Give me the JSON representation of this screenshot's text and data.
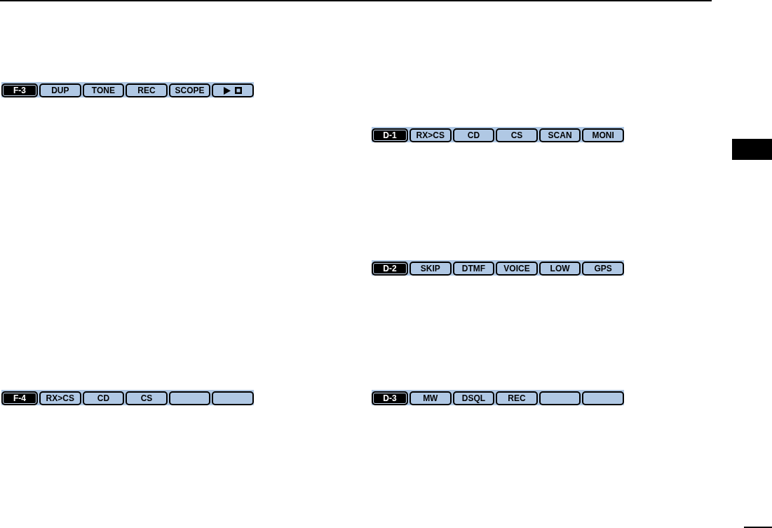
{
  "columns": [
    {
      "bars": [
        {
          "page": "F-3",
          "keys": [
            {
              "kind": "label",
              "label": "DUP"
            },
            {
              "kind": "label",
              "label": "TONE"
            },
            {
              "kind": "label",
              "label": "REC"
            },
            {
              "kind": "label",
              "label": "SCOPE"
            },
            {
              "kind": "media"
            }
          ]
        },
        {
          "page": "F-4",
          "keys": [
            {
              "kind": "label",
              "label": "RX>CS"
            },
            {
              "kind": "label",
              "label": "CD"
            },
            {
              "kind": "label",
              "label": "CS"
            },
            {
              "kind": "blank"
            },
            {
              "kind": "blank"
            }
          ]
        }
      ]
    },
    {
      "bars": [
        {
          "page": "D-1",
          "keys": [
            {
              "kind": "label",
              "label": "RX>CS"
            },
            {
              "kind": "label",
              "label": "CD"
            },
            {
              "kind": "label",
              "label": "CS"
            },
            {
              "kind": "label",
              "label": "SCAN"
            },
            {
              "kind": "label",
              "label": "MONI"
            }
          ]
        },
        {
          "page": "D-2",
          "keys": [
            {
              "kind": "label",
              "label": "SKIP"
            },
            {
              "kind": "label",
              "label": "DTMF"
            },
            {
              "kind": "label",
              "label": "VOICE"
            },
            {
              "kind": "label",
              "label": "LOW"
            },
            {
              "kind": "label",
              "label": "GPS"
            }
          ]
        },
        {
          "page": "D-3",
          "keys": [
            {
              "kind": "label",
              "label": "MW"
            },
            {
              "kind": "label",
              "label": "DSQL"
            },
            {
              "kind": "label",
              "label": "REC"
            },
            {
              "kind": "blank"
            },
            {
              "kind": "blank"
            }
          ]
        }
      ]
    }
  ]
}
